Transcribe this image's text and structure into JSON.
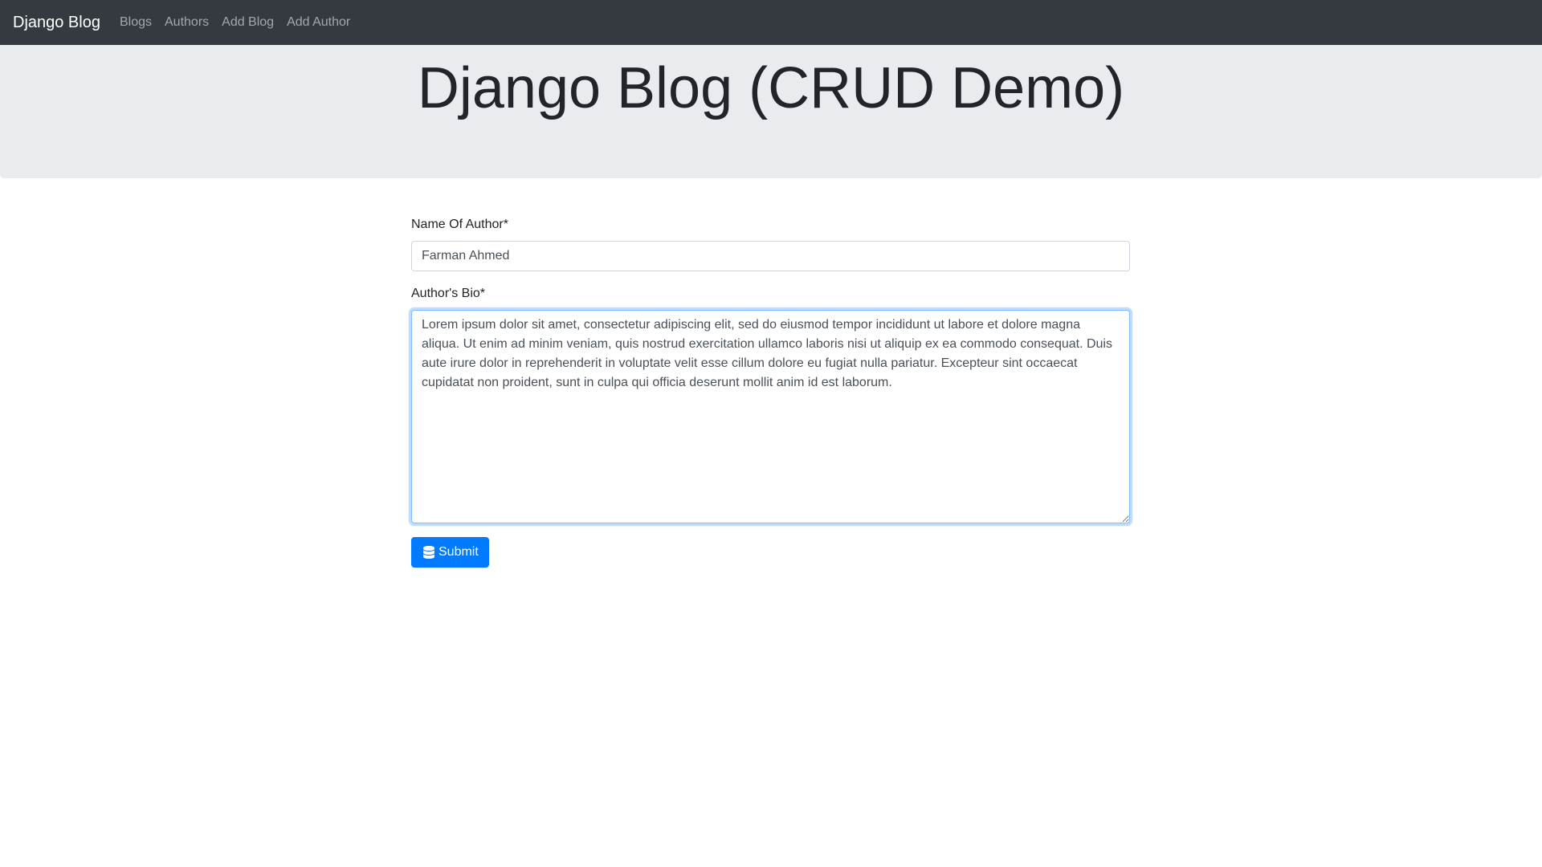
{
  "navbar": {
    "brand": "Django Blog",
    "links": [
      "Blogs",
      "Authors",
      "Add Blog",
      "Add Author"
    ]
  },
  "jumbotron": {
    "title": "Django Blog (CRUD Demo)"
  },
  "form": {
    "name_label": "Name Of Author*",
    "name_value": "Farman Ahmed",
    "bio_label": "Author's Bio*",
    "bio_value": "Lorem ipsum dolor sit amet, consectetur adipiscing elit, sed do eiusmod tempor incididunt ut labore et dolore magna aliqua. Ut enim ad minim veniam, quis nostrud exercitation ullamco laboris nisi ut aliquip ex ea commodo consequat. Duis aute irure dolor in reprehenderit in voluptate velit esse cillum dolore eu fugiat nulla pariatur. Excepteur sint occaecat cupidatat non proident, sunt in culpa qui officia deserunt mollit anim id est laborum.",
    "submit_label": "Submit",
    "submit_icon": "database-icon"
  },
  "colors": {
    "navbar_bg": "#343a40",
    "jumbotron_bg": "#e9ecef",
    "primary": "#007bff"
  }
}
